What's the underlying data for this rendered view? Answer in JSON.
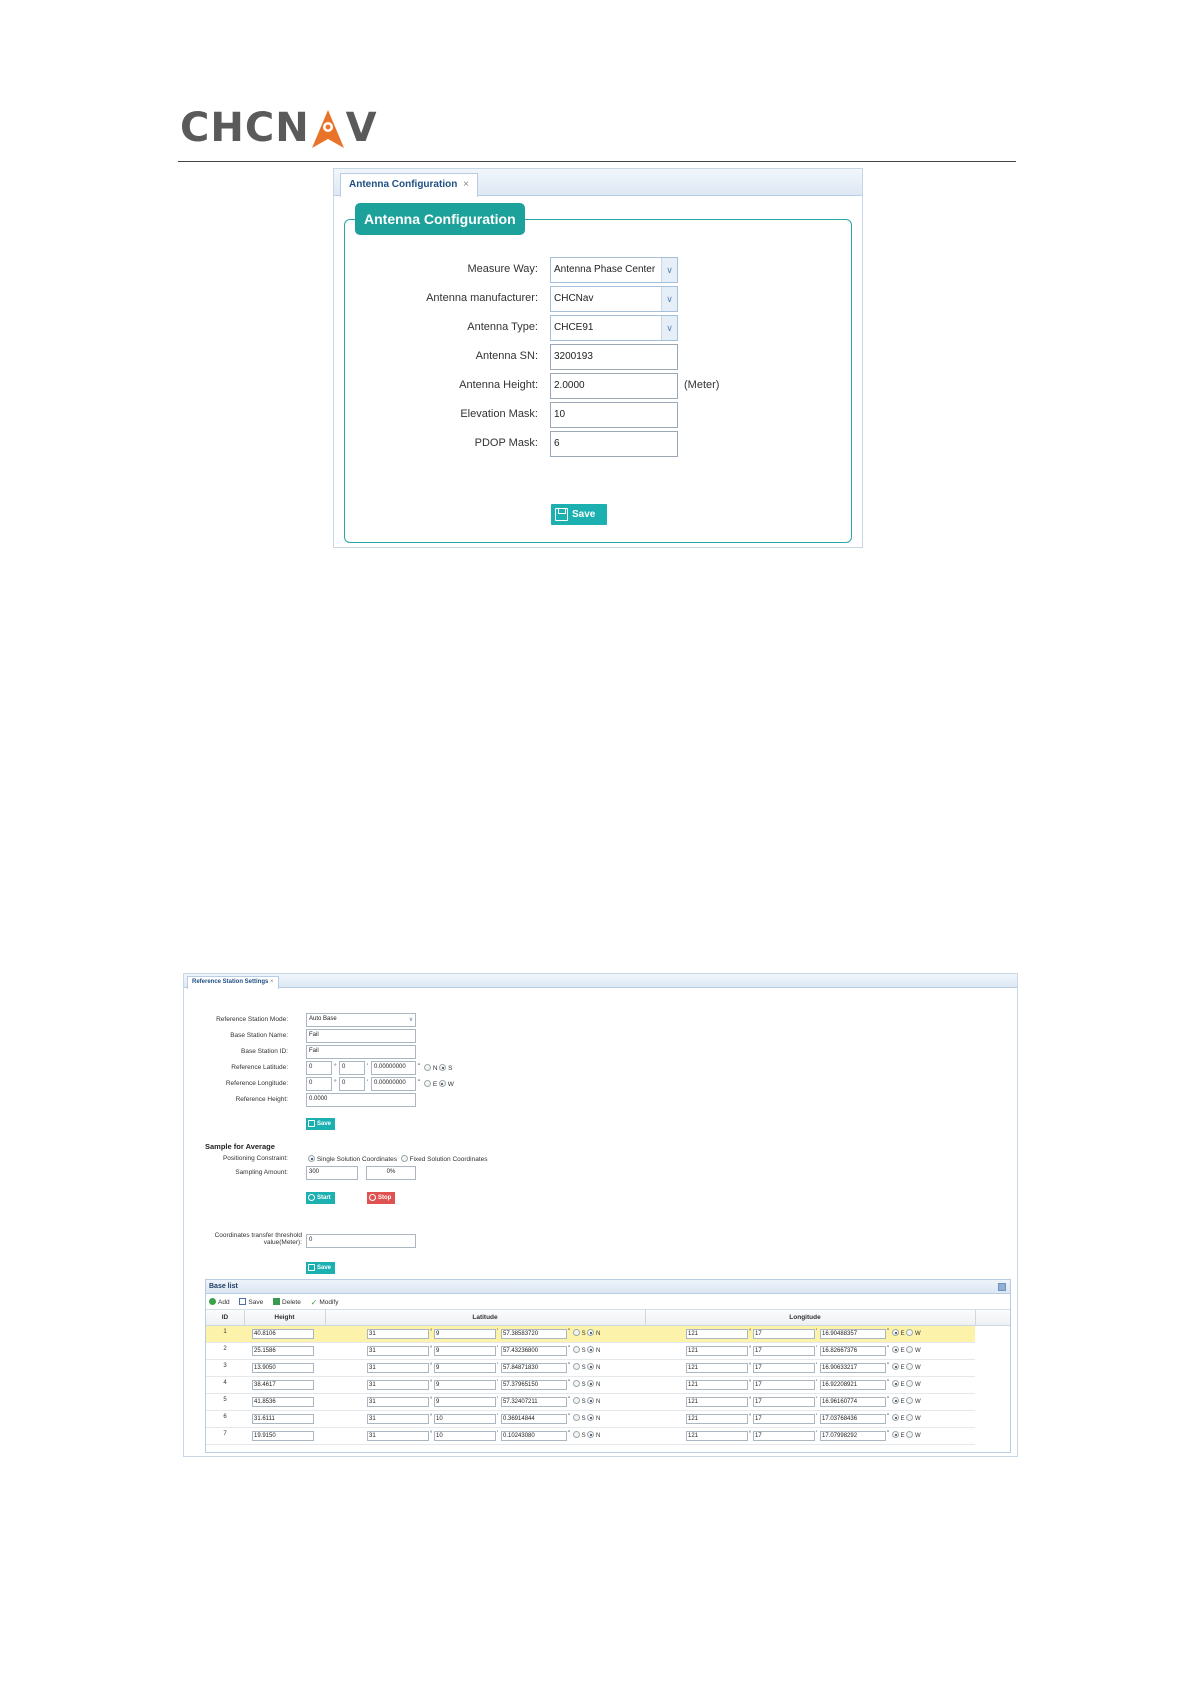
{
  "brand": {
    "logo_text_left": "CHCN",
    "logo_text_right": "V",
    "accent_color": "#e8742a"
  },
  "antenna": {
    "tab_label": "Antenna Configuration",
    "tab_close": "×",
    "legend": "Antenna Configuration",
    "fields": {
      "measure_way": {
        "label": "Measure Way:",
        "value": "Antenna Phase Center"
      },
      "manufacturer": {
        "label": "Antenna manufacturer:",
        "value": "CHCNav"
      },
      "type": {
        "label": "Antenna Type:",
        "value": "CHCE91"
      },
      "sn": {
        "label": "Antenna SN:",
        "value": "3200193"
      },
      "height": {
        "label": "Antenna Height:",
        "value": "2.0000",
        "unit": "(Meter)"
      },
      "elevation": {
        "label": "Elevation Mask:",
        "value": "10"
      },
      "pdop": {
        "label": "PDOP Mask:",
        "value": "6"
      }
    },
    "save_label": "Save",
    "accent": "#1ca29a"
  },
  "reference": {
    "tab_label": "Reference Station Settings",
    "tab_close": "×",
    "mode": {
      "label": "Reference Station Mode:",
      "value": "Auto Base"
    },
    "name": {
      "label": "Base Station Name:",
      "value": "Fail"
    },
    "id": {
      "label": "Base Station ID:",
      "value": "Fail"
    },
    "lat": {
      "label": "Reference Latitude:",
      "deg": "0",
      "min": "0",
      "sec": "0.00000000",
      "opt1": "N",
      "opt2": "S"
    },
    "lon": {
      "label": "Reference Longitude:",
      "deg": "0",
      "min": "0",
      "sec": "0.00000000",
      "opt1": "E",
      "opt2": "W"
    },
    "height": {
      "label": "Reference Height:",
      "value": "0.0000"
    },
    "save_label": "Save",
    "sample": {
      "title": "Sample for Average",
      "constraint_label": "Positioning Constraint:",
      "opt_single": "Single Solution Coordinates",
      "opt_fixed": "Fixed Solution Coordinates",
      "amount_label": "Sampling Amount:",
      "amount_value": "300",
      "progress": "0%",
      "start_label": "Start",
      "stop_label": "Stop"
    },
    "threshold": {
      "label_line1": "Coordinates transfer threshold",
      "label_line2": "value(Meter):",
      "value": "0",
      "save_label": "Save"
    },
    "baselist": {
      "title": "Base list",
      "toolbar": {
        "add": "Add",
        "save": "Save",
        "delete": "Delete",
        "modify": "Modify"
      },
      "headers": {
        "id": "ID",
        "height": "Height",
        "latitude": "Latitude",
        "longitude": "Longitude"
      },
      "symbols": {
        "deg": "°",
        "min": "'",
        "sec": "\""
      },
      "rows": [
        {
          "id": "1",
          "height": "40.8106",
          "lat_d": "31",
          "lat_m": "9",
          "lat_s": "57.38583720",
          "ns": "N",
          "lon_d": "121",
          "lon_m": "17",
          "lon_s": "16.90488357",
          "ew": "E"
        },
        {
          "id": "2",
          "height": "25.1586",
          "lat_d": "31",
          "lat_m": "9",
          "lat_s": "57.43236800",
          "ns": "N",
          "lon_d": "121",
          "lon_m": "17",
          "lon_s": "16.82667376",
          "ew": "E"
        },
        {
          "id": "3",
          "height": "13.9050",
          "lat_d": "31",
          "lat_m": "9",
          "lat_s": "57.84871830",
          "ns": "N",
          "lon_d": "121",
          "lon_m": "17",
          "lon_s": "16.90633217",
          "ew": "E"
        },
        {
          "id": "4",
          "height": "38.4617",
          "lat_d": "31",
          "lat_m": "9",
          "lat_s": "57.37965150",
          "ns": "N",
          "lon_d": "121",
          "lon_m": "17",
          "lon_s": "16.92208921",
          "ew": "E"
        },
        {
          "id": "5",
          "height": "41.8536",
          "lat_d": "31",
          "lat_m": "9",
          "lat_s": "57.32407211",
          "ns": "N",
          "lon_d": "121",
          "lon_m": "17",
          "lon_s": "16.96160774",
          "ew": "E"
        },
        {
          "id": "6",
          "height": "31.6111",
          "lat_d": "31",
          "lat_m": "10",
          "lat_s": "0.36914844",
          "ns": "N",
          "lon_d": "121",
          "lon_m": "17",
          "lon_s": "17.03768436",
          "ew": "E"
        },
        {
          "id": "7",
          "height": "19.9150",
          "lat_d": "31",
          "lat_m": "10",
          "lat_s": "0.10243080",
          "ns": "N",
          "lon_d": "121",
          "lon_m": "17",
          "lon_s": "17.07998292",
          "ew": "E"
        }
      ]
    }
  }
}
